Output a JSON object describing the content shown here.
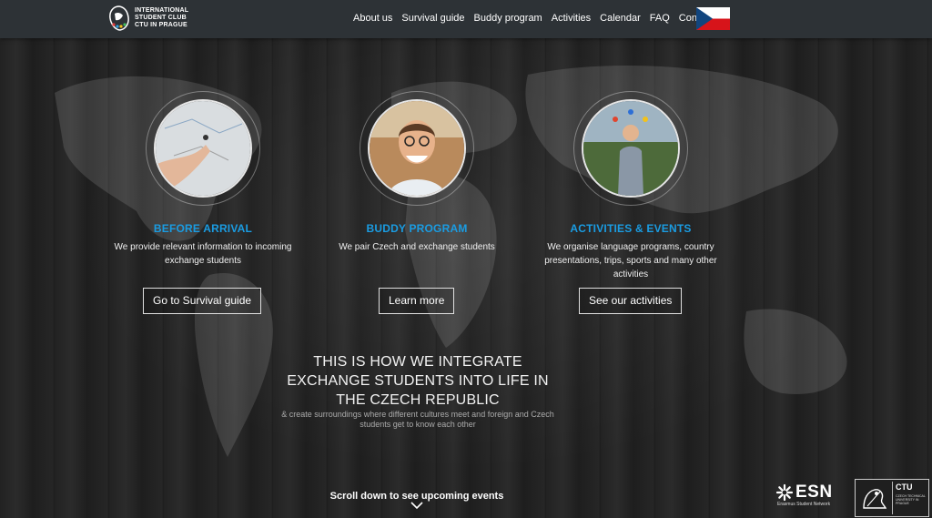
{
  "header": {
    "logo_lines": [
      "INTERNATIONAL",
      "STUDENT CLUB",
      "CTU IN PRAGUE"
    ],
    "nav": [
      "About us",
      "Survival guide",
      "Buddy program",
      "Activities",
      "Calendar",
      "FAQ",
      "Contacts"
    ],
    "language_flag": "czech-flag-icon"
  },
  "cards": [
    {
      "title": "BEFORE ARRIVAL",
      "desc": "We provide relevant information to incoming exchange students",
      "button": "Go to Survival guide"
    },
    {
      "title": "BUDDY PROGRAM",
      "desc": "We pair Czech and exchange students",
      "button": "Learn more"
    },
    {
      "title": "ACTIVITIES & EVENTS",
      "desc": "We organise language programs, country presentations, trips, sports and many other activities",
      "button": "See our activities"
    }
  ],
  "main": {
    "headline": "THIS IS HOW WE INTEGRATE EXCHANGE STUDENTS INTO LIFE IN THE CZECH REPUBLIC",
    "subline": "& create surroundings where different cultures meet and foreign and Czech students get to know each other",
    "scroll": "Scroll down to see upcoming events"
  },
  "footer_logos": {
    "esn_name": "ESN",
    "esn_sub": "Erasmus Student Network",
    "ctu_name": "CTU",
    "ctu_sub": "CZECH TECHNICAL UNIVERSITY IN PRAGUE"
  },
  "colors": {
    "accent": "#1a9ce2",
    "topbar": "#2d3236"
  }
}
